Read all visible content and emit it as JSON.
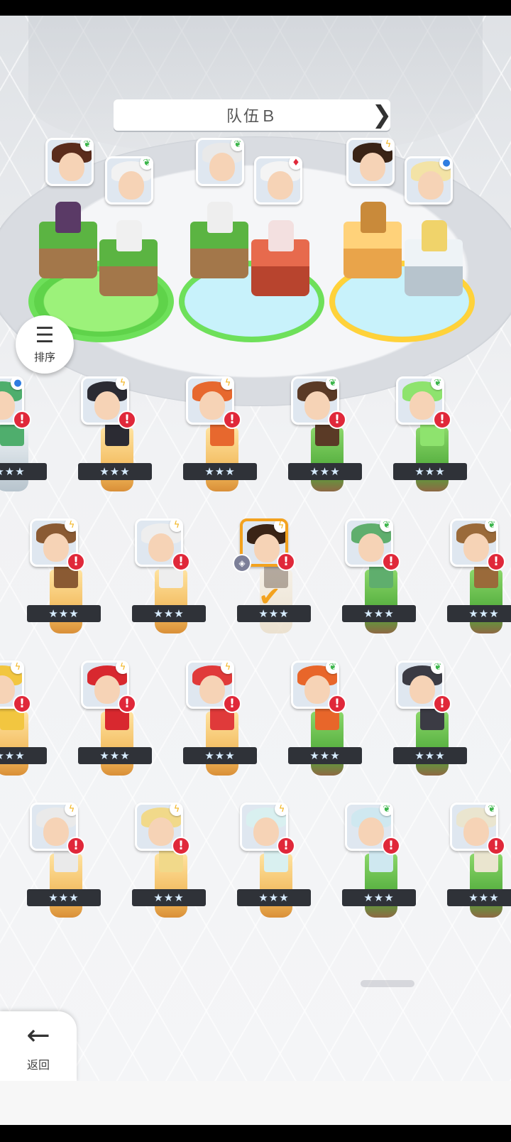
{
  "team": {
    "title": "队伍Ｂ",
    "prev_arrow": "❮",
    "next_arrow": "❯"
  },
  "sort_button": {
    "icon": "sort-icon",
    "label": "排序"
  },
  "back_button": {
    "icon": "arrow-left-icon",
    "label": "返回"
  },
  "colors": {
    "alert": "#e0283a",
    "selected_border": "#f3a21e",
    "ring_green": "#6ee05a",
    "ring_yellow": "#ffd23a"
  },
  "team_members": [
    {
      "element": "nature",
      "element_icon": "leaf-icon",
      "hair": "#5a2c1c"
    },
    {
      "element": "nature",
      "element_icon": "leaf-icon",
      "hair": "#f2f2f2"
    },
    {
      "element": "nature",
      "element_icon": "leaf-icon",
      "hair": "#e9e9e9"
    },
    {
      "element": "fire",
      "element_icon": "fire-icon",
      "hair": "#f4f4f4"
    },
    {
      "element": "thunder",
      "element_icon": "lightning-icon",
      "hair": "#3a2416"
    },
    {
      "element": "water",
      "element_icon": "water-icon",
      "hair": "#f3e3a6"
    }
  ],
  "roster": [
    {
      "element_icon": "water-icon",
      "stars": "★★★",
      "alert": "!",
      "hair": "#4fae6d",
      "pillar": "ice"
    },
    {
      "element_icon": "lightning-icon",
      "stars": "★★★",
      "alert": "!",
      "hair": "#2b2b33",
      "pillar": "gold"
    },
    {
      "element_icon": "lightning-icon",
      "stars": "★★★",
      "alert": "!",
      "hair": "#e7682e",
      "pillar": "gold"
    },
    {
      "element_icon": "leaf-icon",
      "stars": "★★★",
      "alert": "!",
      "hair": "#5a3a26",
      "pillar": "green"
    },
    {
      "element_icon": "leaf-icon",
      "stars": "★★★",
      "alert": "!",
      "hair": "#8ee36e",
      "pillar": "green"
    },
    {
      "element_icon": "lightning-icon",
      "stars": "★★★",
      "alert": "!",
      "hair": "#8a5a33",
      "pillar": "gold"
    },
    {
      "element_icon": "lightning-icon",
      "stars": "★★★",
      "alert": "!",
      "hair": "#eeeeee",
      "pillar": "gold"
    },
    {
      "element_icon": "lightning-icon",
      "stars": "★★★",
      "alert": "!",
      "hair": "#3a2416",
      "pillar": "ghost",
      "selected": true
    },
    {
      "element_icon": "leaf-icon",
      "stars": "★★★",
      "alert": "!",
      "hair": "#5fae6d",
      "pillar": "green"
    },
    {
      "element_icon": "leaf-icon",
      "stars": "★★★",
      "alert": "!",
      "hair": "#9a6a3a",
      "pillar": "green"
    },
    {
      "element_icon": "lightning-icon",
      "stars": "★★★",
      "alert": "!",
      "hair": "#f2c640",
      "pillar": "gold"
    },
    {
      "element_icon": "lightning-icon",
      "stars": "★★★",
      "alert": "!",
      "hair": "#d8282f",
      "pillar": "gold"
    },
    {
      "element_icon": "lightning-icon",
      "stars": "★★★",
      "alert": "!",
      "hair": "#e03a3a",
      "pillar": "gold"
    },
    {
      "element_icon": "leaf-icon",
      "stars": "★★★",
      "alert": "!",
      "hair": "#e8662a",
      "pillar": "green"
    },
    {
      "element_icon": "leaf-icon",
      "stars": "★★★",
      "alert": "!",
      "hair": "#3b3b44",
      "pillar": "green"
    },
    {
      "element_icon": "lightning-icon",
      "stars": "★★★",
      "alert": "!",
      "hair": "#eaeaea",
      "pillar": "gold"
    },
    {
      "element_icon": "lightning-icon",
      "stars": "★★★",
      "alert": "!",
      "hair": "#f1d98a",
      "pillar": "gold"
    },
    {
      "element_icon": "lightning-icon",
      "stars": "★★★",
      "alert": "!",
      "hair": "#d9f0f0",
      "pillar": "gold"
    },
    {
      "element_icon": "leaf-icon",
      "stars": "★★★",
      "alert": "!",
      "hair": "#cfe8f0",
      "pillar": "green"
    },
    {
      "element_icon": "leaf-icon",
      "stars": "★★★",
      "alert": "!",
      "hair": "#eae5cf",
      "pillar": "green"
    }
  ]
}
